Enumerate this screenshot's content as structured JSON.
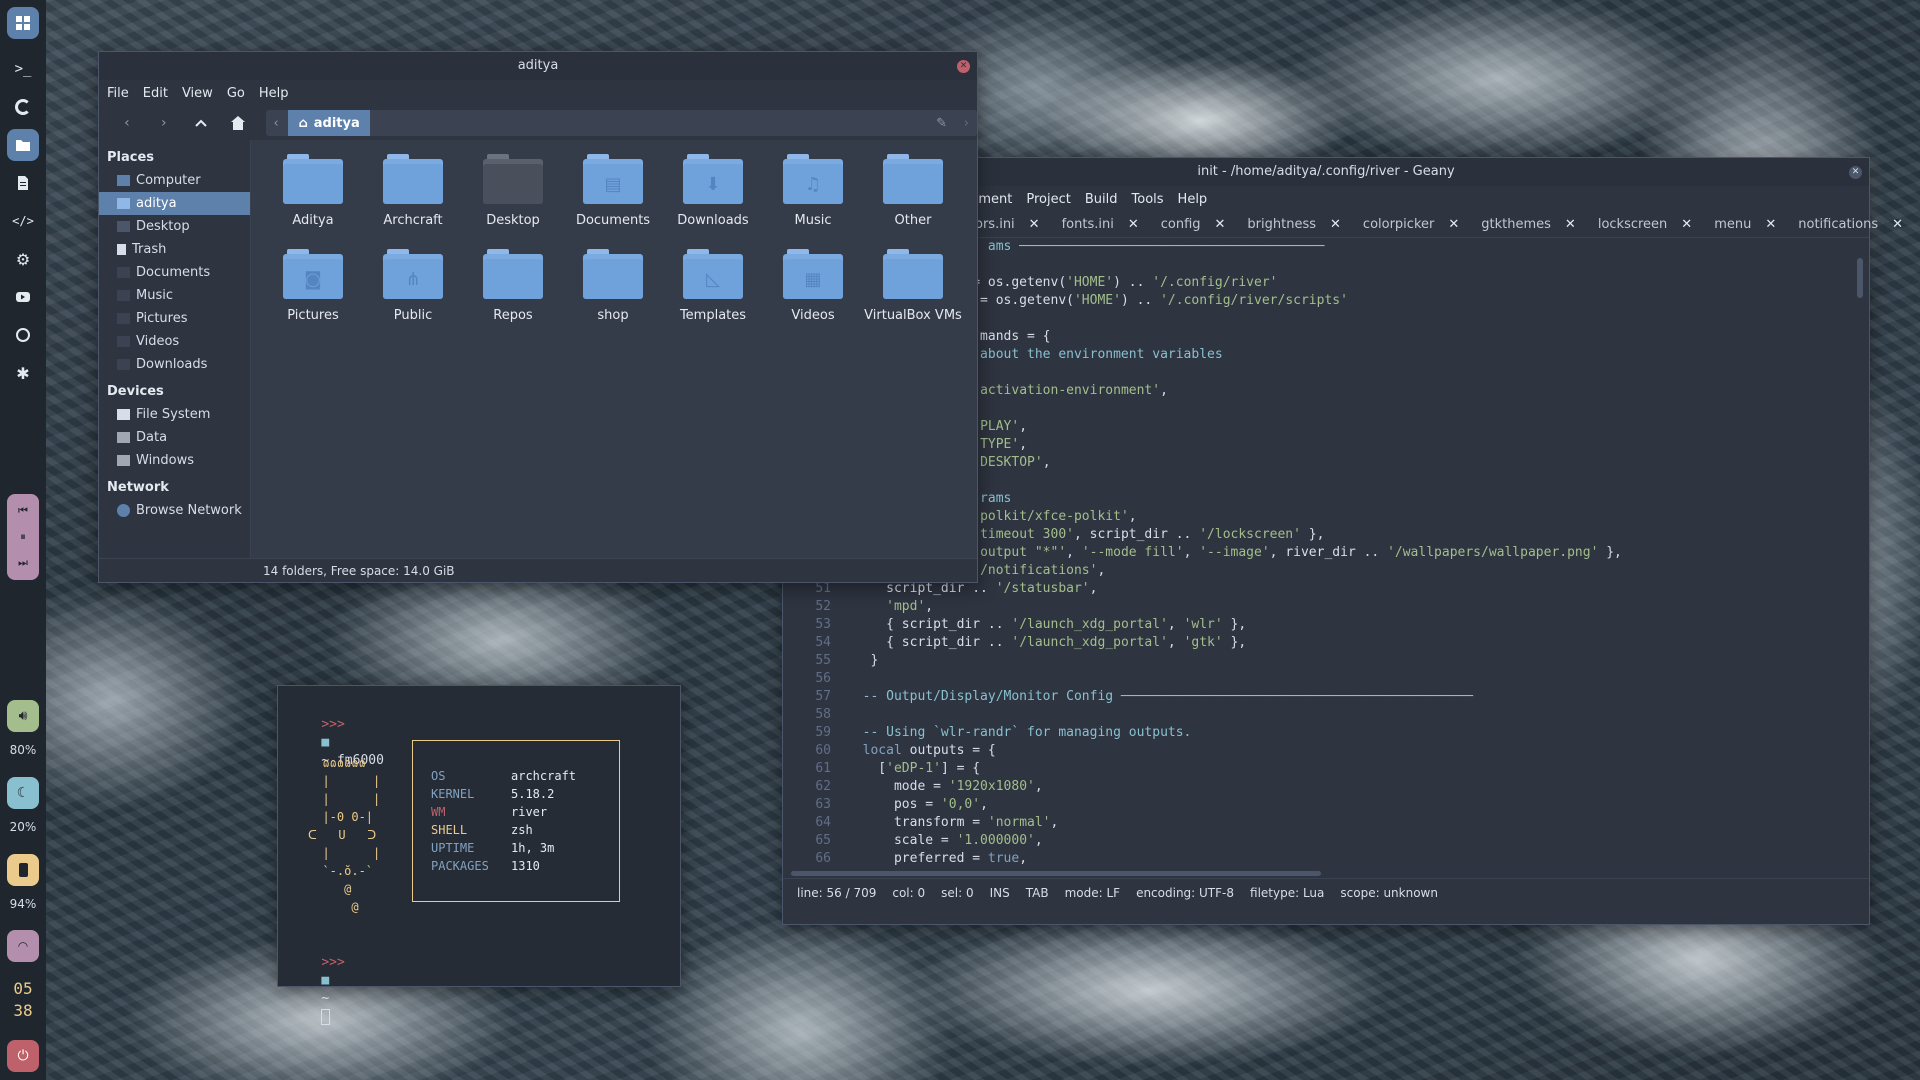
{
  "dock": {
    "volume": "80%",
    "brightness": "20%",
    "battery": "94%",
    "clock_hour": "05",
    "clock_minute": "38"
  },
  "file_manager": {
    "title": "aditya",
    "menu": [
      "File",
      "Edit",
      "View",
      "Go",
      "Help"
    ],
    "path": "aditya",
    "places_header": "Places",
    "places": [
      "Computer",
      "aditya",
      "Desktop",
      "Trash",
      "Documents",
      "Music",
      "Pictures",
      "Videos",
      "Downloads"
    ],
    "devices_header": "Devices",
    "devices": [
      "File System",
      "Data",
      "Windows"
    ],
    "network_header": "Network",
    "network": [
      "Browse Network"
    ],
    "folders": [
      "Aditya",
      "Archcraft",
      "Desktop",
      "Documents",
      "Downloads",
      "Music",
      "Other",
      "Pictures",
      "Public",
      "Repos",
      "shop",
      "Templates",
      "Videos",
      "VirtualBox VMs"
    ],
    "status": "14 folders, Free space: 14.0 GiB"
  },
  "geany": {
    "title": "init - /home/aditya/.config/river - Geany",
    "menu": [
      "cument",
      "Project",
      "Build",
      "Tools",
      "Help"
    ],
    "tabs": [
      "ors.ini",
      "fonts.ini",
      "config",
      "brightness",
      "colorpicker",
      "gtkthemes",
      "lockscreen",
      "menu",
      "notifications"
    ],
    "gutter": [
      "",
      "",
      "",
      "",
      "",
      "",
      "",
      "",
      "",
      "",
      "",
      "",
      "",
      "",
      "",
      "",
      "",
      "",
      "",
      "51",
      "52",
      "53",
      "54",
      "55",
      "56",
      "57",
      "58",
      "59",
      "60",
      "61",
      "62",
      "63",
      "64",
      "65",
      "66"
    ],
    "status": {
      "line": "line: 56 / 709",
      "col": "col: 0",
      "sel": "sel: 0",
      "ins": "INS",
      "tab": "TAB",
      "mode": "mode: LF",
      "encoding": "encoding: UTF-8",
      "filetype": "filetype: Lua",
      "scope": "scope: unknown"
    }
  },
  "terminal": {
    "prompt_arrows": ">>>",
    "prompt1_path": "~ fm6000",
    "prompt2_path": "~",
    "fetch": [
      {
        "key": "OS",
        "value": "archcraft"
      },
      {
        "key": "KERNEL",
        "value": "5.18.2"
      },
      {
        "key": "WM",
        "value": "river"
      },
      {
        "key": "SHELL",
        "value": "zsh"
      },
      {
        "key": "UPTIME",
        "value": "1h, 3m"
      },
      {
        "key": "PACKAGES",
        "value": "1310"
      }
    ]
  },
  "colors": {
    "accent": "#5e81ac",
    "dock_bg": "#1f262e",
    "window_bg": "#2e3440",
    "media_pill": "#b48ead",
    "volume_pill": "#a3be8c",
    "brightness_pill": "#88c0d0",
    "battery_pill": "#ebcb8b",
    "wifi_pill": "#b48ead",
    "power_pill": "#bf616a"
  }
}
